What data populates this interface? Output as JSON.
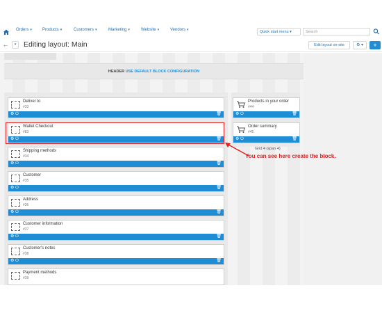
{
  "nav": {
    "items": [
      "Orders",
      "Products",
      "Customers",
      "Marketing",
      "Website",
      "Vendors"
    ],
    "quick_menu": "Quick start menu",
    "search_placeholder": "Search"
  },
  "titlebar": {
    "title": "Editing layout: Main",
    "edit_on_site": "Edit layout on-site"
  },
  "header_block": {
    "label": "HEADER",
    "link": "USE DEFAULT BLOCK CONFIGURATION"
  },
  "main_blocks": [
    {
      "name": "Deliver to",
      "id": "#33"
    },
    {
      "name": "Wallet Checkout",
      "id": "#83"
    },
    {
      "name": "Shipping methods",
      "id": "#34"
    },
    {
      "name": "Customer",
      "id": "#35"
    },
    {
      "name": "Address",
      "id": "#36"
    },
    {
      "name": "Customer information",
      "id": "#37"
    },
    {
      "name": "Customer's notes",
      "id": "#38"
    },
    {
      "name": "Payment methods",
      "id": "#39"
    }
  ],
  "side_blocks": [
    {
      "name": "Products in your order",
      "id": "#44"
    },
    {
      "name": "Order summary",
      "id": "#45"
    }
  ],
  "grid_label": "Grid 4 (span 4)",
  "annotation": "You can see here create the block.",
  "colors": {
    "accent": "#1f8dd6",
    "link": "#1f6fb2",
    "highlight": "#e02020"
  }
}
